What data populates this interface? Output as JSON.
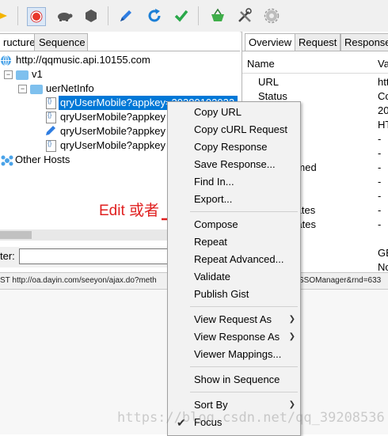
{
  "left_panel": {
    "tabs": [
      "ructure",
      "Sequence"
    ],
    "tree": {
      "host": "http://qqmusic.api.10155.com",
      "v1": "v1",
      "folder": "uerNetInfo",
      "selected_item": "qryUserMobile?appkey",
      "selected_suffix": "=20380102032",
      "items": [
        "qryUserMobile?appkey",
        "qryUserMobile?appkey",
        "qryUserMobile?appkey"
      ],
      "other_hosts": "Other Hosts"
    },
    "filter_label": "ter:",
    "filter_value": ""
  },
  "right_panel": {
    "tabs": [
      "Overview",
      "Request",
      "Response"
    ],
    "header": {
      "name": "Name",
      "value": "Va"
    },
    "rows": [
      {
        "name": "URL",
        "value": "htt"
      },
      {
        "name": "Status",
        "value": "Co"
      },
      {
        "name": "e Code",
        "value": "20"
      },
      {
        "name": "",
        "value": "HT"
      },
      {
        "name": "",
        "value": "-"
      },
      {
        "name": "col",
        "value": "-"
      },
      {
        "name": "on Resumed",
        "value": "-"
      },
      {
        "name": "r Suite",
        "value": "-"
      },
      {
        "name": "",
        "value": "-"
      },
      {
        "name": "t Certificates",
        "value": "-"
      },
      {
        "name": "r Certificates",
        "value": "-"
      },
      {
        "name": "sions",
        "value": ""
      },
      {
        "name": "",
        "value": "GE"
      },
      {
        "name": "",
        "value": "No"
      }
    ]
  },
  "status_bar": {
    "left": "ST http://oa.dayin.com/seeyon/ajax.do?meth",
    "right": "SSOManager&rnd=633"
  },
  "context_menu": {
    "group1": [
      "Copy URL",
      "Copy cURL Request",
      "Copy Response",
      "Save Response...",
      "Find In...",
      "Export..."
    ],
    "group2": [
      "Compose",
      "Repeat",
      "Repeat Advanced...",
      "Validate",
      "Publish Gist"
    ],
    "group3": [
      "View Request As",
      "View Response As",
      "Viewer Mappings..."
    ],
    "group4": [
      "Show in Sequence"
    ],
    "group5": [
      "Sort By",
      "Focus"
    ]
  },
  "annotation": "Edit 或者",
  "watermark": "https://blog.csdn.net/qq_39208536",
  "colors": {
    "selection": "#0078d7",
    "annotation": "#e02020",
    "record_button": "#e8362b",
    "check_green": "#2aa84a",
    "refresh_blue": "#1c7fd6"
  }
}
